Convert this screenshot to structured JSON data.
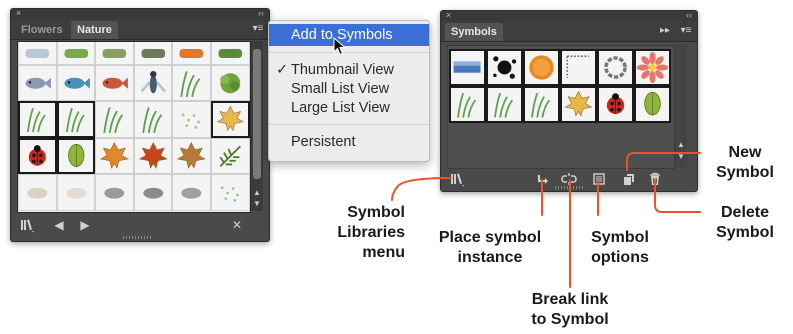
{
  "left_panel": {
    "tabs": [
      "Flowers",
      "Nature"
    ],
    "active_tab": "Nature",
    "close_glyph": "×",
    "collapse_glyph": "‹‹",
    "menu_icon": "panel-menu-icon",
    "rows": [
      [
        "partial-oval",
        "partial-green",
        "partial-plant",
        "partial-dragonfly",
        "partial-flame",
        "partial-bush"
      ],
      [
        "fish-bowl",
        "fish-blue",
        "fish-red",
        "fly-insect",
        "grass-tuft",
        "shrub"
      ],
      [
        "grass-blade",
        "grass-tall",
        "grass-bunch",
        "grass-low",
        "mist-dots",
        "maple-leaf-yellow"
      ],
      [
        "ladybug",
        "green-leaf",
        "maple-leaf-orange",
        "maple-leaf-red",
        "maple-leaf-brown",
        "fern-leaf"
      ],
      [
        "pebble-light",
        "pebble-small",
        "stone-gray",
        "rock-gray",
        "rock-flat",
        "gravel"
      ]
    ],
    "selected_cells": [
      "grass-blade",
      "grass-tall",
      "maple-leaf-yellow",
      "ladybug",
      "green-leaf"
    ],
    "bottom_icons": [
      "symbol-libraries-icon",
      "prev-arrow-icon",
      "next-arrow-icon",
      "close-library-icon"
    ]
  },
  "flyout_menu": {
    "items": [
      {
        "label": "Add to Symbols",
        "checked": false,
        "highlighted": true
      },
      {
        "label": "Thumbnail View",
        "checked": true,
        "highlighted": false
      },
      {
        "label": "Small List View",
        "checked": false,
        "highlighted": false
      },
      {
        "label": "Large List View",
        "checked": false,
        "highlighted": false
      },
      {
        "label": "Persistent",
        "checked": false,
        "highlighted": false
      }
    ],
    "check_glyph": "✓"
  },
  "right_panel": {
    "tab": "Symbols",
    "close_glyph": "×",
    "collapse_glyph": "‹‹",
    "expand_glyph": "▸▸",
    "rows": [
      [
        "blue-gradient-bar",
        "ink-splat",
        "orange-sphere",
        "dotted-corner",
        "chain-ring",
        "pink-flower"
      ],
      [
        "grass-blade",
        "grass-tall",
        "grass-low",
        "maple-leaf-yellow",
        "ladybug",
        "green-leaf"
      ]
    ],
    "bottom_icons": [
      "symbol-libraries-icon",
      "place-instance-icon",
      "break-link-icon",
      "symbol-options-icon",
      "new-symbol-icon",
      "delete-symbol-icon"
    ]
  },
  "callouts": {
    "symbol_libraries": [
      "Symbol",
      "Libraries",
      "menu"
    ],
    "place_instance": [
      "Place symbol",
      "instance"
    ],
    "break_link": [
      "Break link",
      "to Symbol"
    ],
    "symbol_options": [
      "Symbol",
      "options"
    ],
    "new_symbol": [
      "New",
      "Symbol"
    ],
    "delete_symbol": [
      "Delete",
      "Symbol"
    ]
  },
  "colors": {
    "panel_bg": "#4a4a4a",
    "well_bg": "#efefef",
    "menu_highlight": "#3a6fd8",
    "callout_line": "#e8542a"
  }
}
